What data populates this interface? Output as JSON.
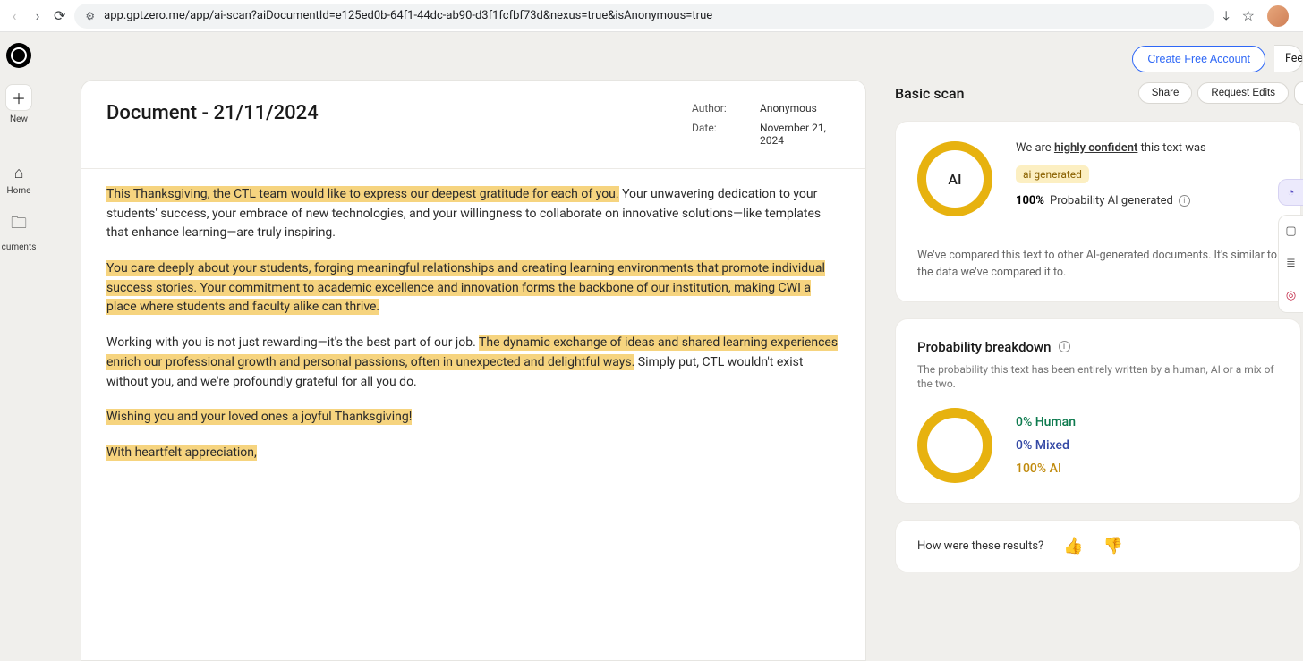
{
  "browser": {
    "url": "app.gptzero.me/app/ai-scan?aiDocumentId=e125ed0b-64f1-44dc-ab90-d3f1fcfbf73d&nexus=true&isAnonymous=true"
  },
  "rail": {
    "new": "New",
    "home": "Home",
    "documents": "cuments"
  },
  "header": {
    "create_account": "Create Free Account",
    "feedback_cut": "Fee"
  },
  "doc": {
    "title": "Document - 21/11/2024",
    "meta": {
      "author_label": "Author:",
      "author_value": "Anonymous",
      "date_label": "Date:",
      "date_value": "November 21, 2024"
    },
    "p1": {
      "h1": "This Thanksgiving, the CTL team would like to express our deepest gratitude for each of you.",
      "t1": " Your unwavering dedication to your students' success, your embrace of new technologies, and your willingness to collaborate on innovative solutions—like templates that enhance learning—are truly inspiring."
    },
    "p2": {
      "h1": "You care deeply about your students, forging meaningful relationships and creating learning environments that promote individual success stories.",
      "h2": " Your commitment to academic excellence and innovation forms the backbone of our institution, making CWI a place where students and faculty alike can thrive."
    },
    "p3": {
      "t1": "Working with you is not just rewarding—it's the best part of our job. ",
      "h1": "The dynamic exchange of ideas and shared learning experiences enrich our professional growth and personal passions, often in unexpected and delightful ways.",
      "t2": " Simply put, CTL wouldn't exist without you, and we're profoundly grateful for all you do."
    },
    "p4": {
      "h1": "Wishing you and your loved ones a joyful Thanksgiving!"
    },
    "p5": {
      "h1": "With heartfelt appreciation,"
    }
  },
  "scan": {
    "title": "Basic scan",
    "share": "Share",
    "request_edits": "Request Edits",
    "verdict": {
      "ring_label": "AI",
      "we_are": "We are ",
      "confident": "highly confident",
      "tail": " this text was",
      "tag": "ai generated",
      "prob_pct": "100%",
      "prob_text": " Probability AI generated ",
      "compare_note": "We've compared this text to other AI-generated documents. It's similar to the data we've compared it to."
    },
    "breakdown": {
      "title": "Probability breakdown",
      "sub": "The probability this text has been entirely written by a human, AI or a mix of the two.",
      "human": "0% Human",
      "mixed": "0% Mixed",
      "ai": "100% AI"
    },
    "feedback": {
      "q": "How were these results?"
    }
  }
}
